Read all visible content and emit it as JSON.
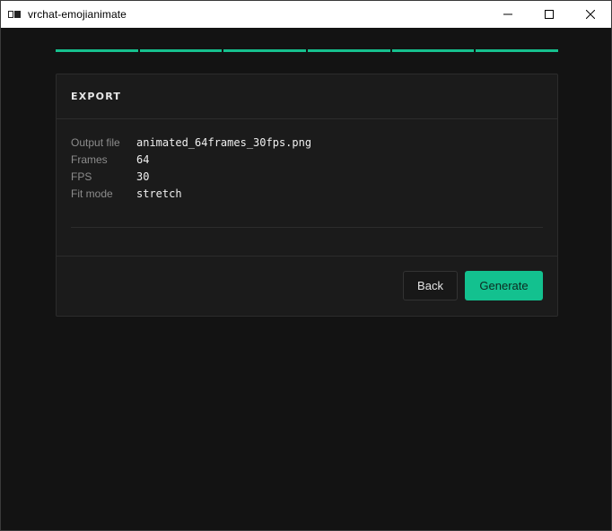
{
  "window": {
    "title": "vrchat-emojianimate",
    "icon": "app-icon",
    "controls": [
      "minimize-icon",
      "maximize-icon",
      "close-icon"
    ]
  },
  "progress": {
    "total_steps": 6,
    "completed_steps": 6,
    "accent_color": "#16c08e"
  },
  "card": {
    "title": "EXPORT",
    "rows": [
      {
        "label": "Output file",
        "value": "animated_64frames_30fps.png"
      },
      {
        "label": "Frames",
        "value": "64"
      },
      {
        "label": "FPS",
        "value": "30"
      },
      {
        "label": "Fit mode",
        "value": "stretch"
      }
    ]
  },
  "actions": {
    "back_label": "Back",
    "generate_label": "Generate",
    "generate_color": "#13c18f"
  }
}
